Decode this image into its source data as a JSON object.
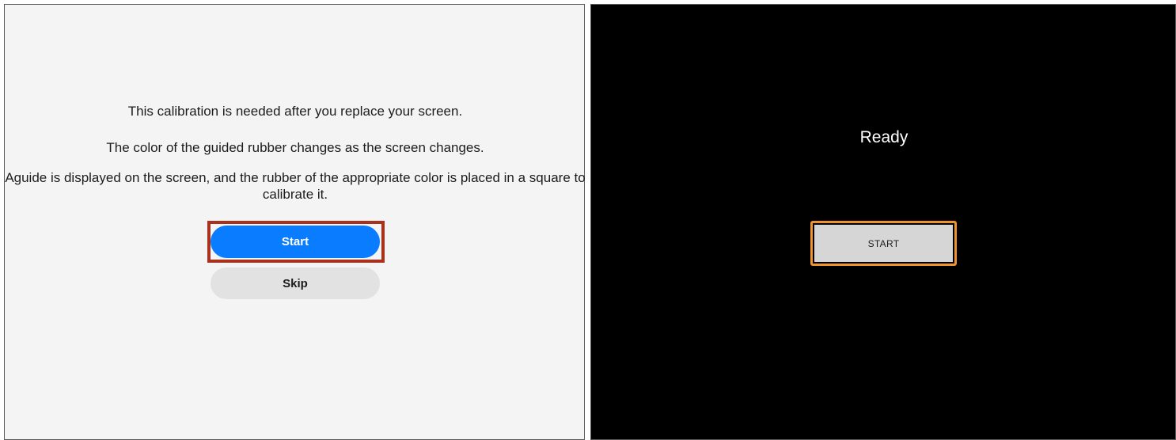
{
  "left_screen": {
    "messages": [
      "This calibration is needed after you replace your screen.",
      "The color of the guided rubber changes as the screen changes.",
      "Aguide is displayed on the screen, and the rubber of the appropriate color is placed in a square to calibrate it."
    ],
    "start_label": "Start",
    "skip_label": "Skip"
  },
  "right_screen": {
    "status": "Ready",
    "start_label": "START"
  },
  "colors": {
    "left_background": "#f4f4f4",
    "right_background": "#000000",
    "start_button": "#0a7cff",
    "skip_button": "#e2e2e2",
    "left_highlight": "#a8321d",
    "right_highlight": "#f0922e",
    "right_start_button": "#d6d6d6"
  }
}
